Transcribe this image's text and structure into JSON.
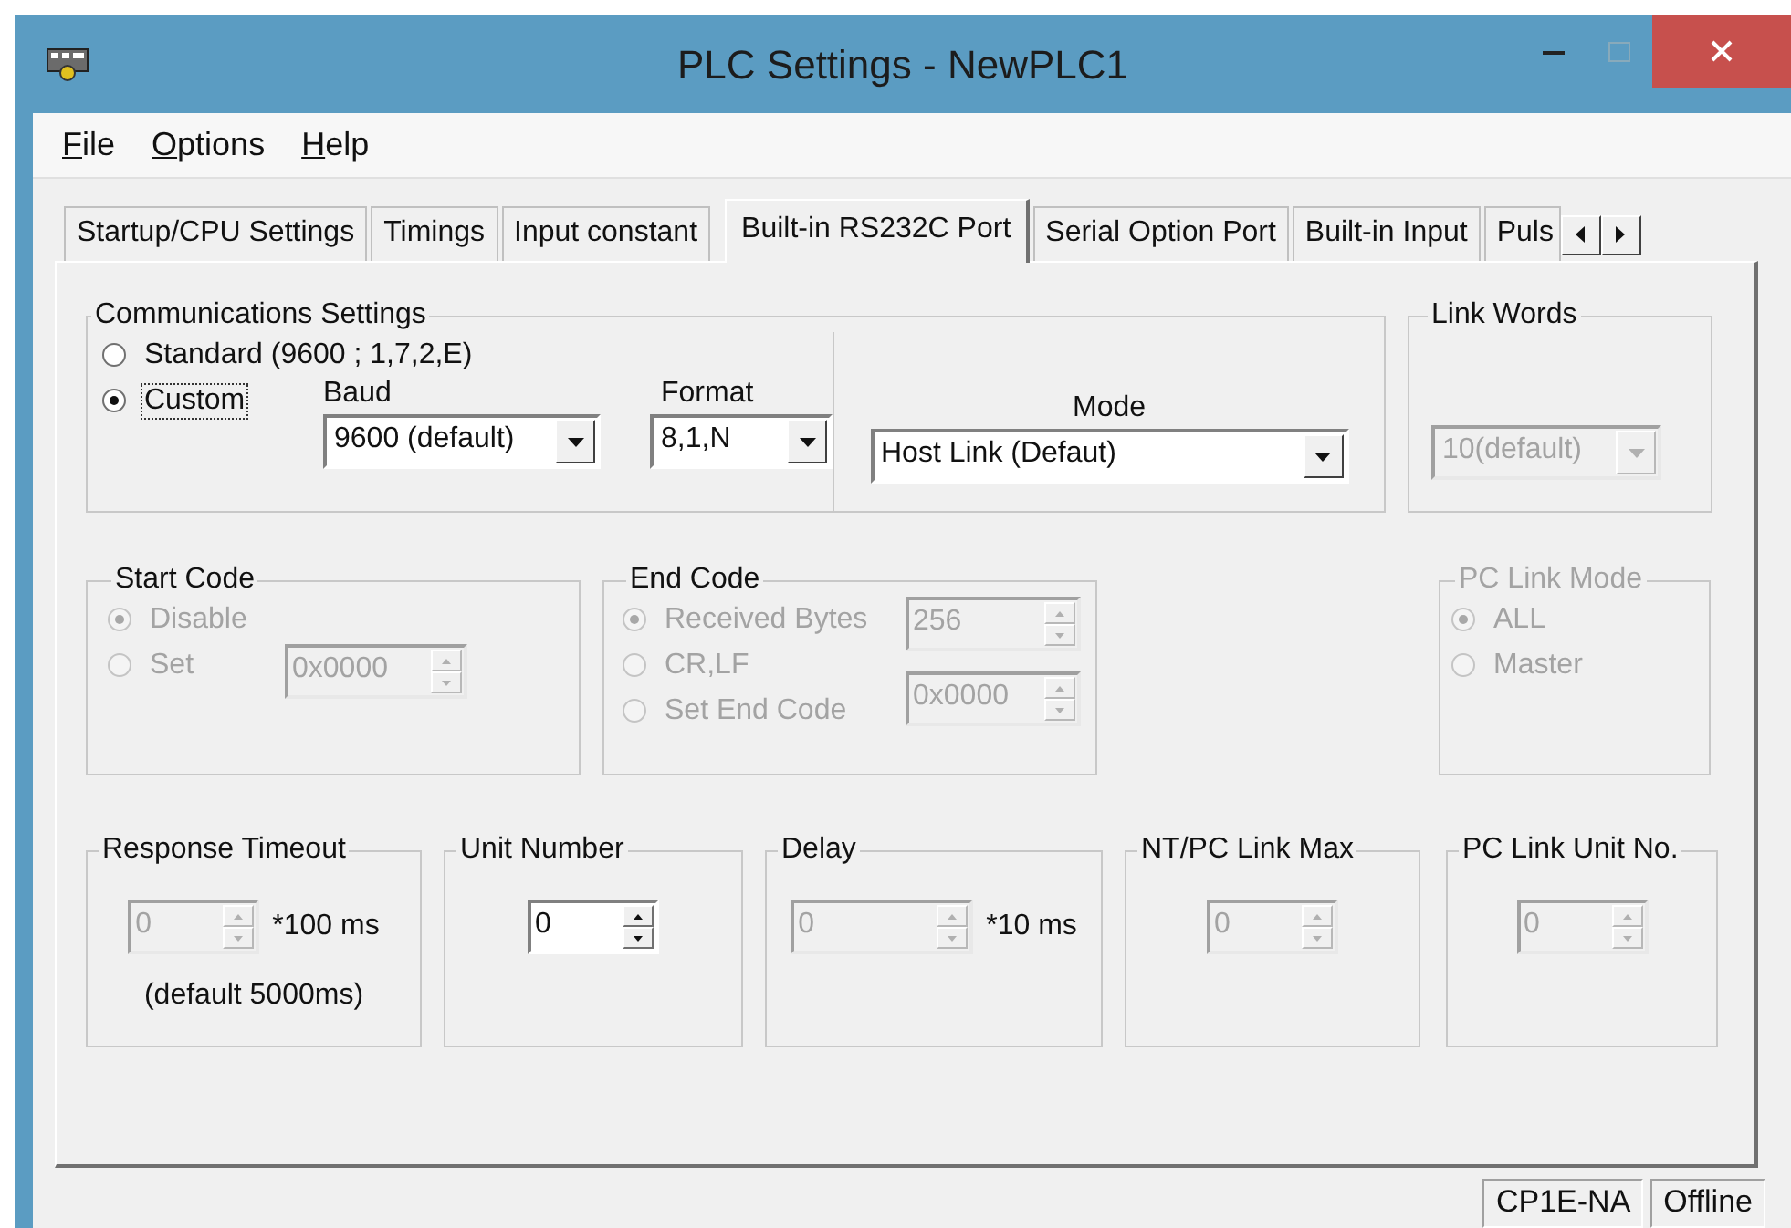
{
  "window": {
    "title": "PLC Settings - NewPLC1"
  },
  "menu": [
    {
      "label": "File"
    },
    {
      "label": "Options"
    },
    {
      "label": "Help"
    }
  ],
  "tabs": [
    {
      "label": "Startup/CPU Settings",
      "selected": false
    },
    {
      "label": "Timings",
      "selected": false
    },
    {
      "label": "Input constant",
      "selected": false
    },
    {
      "label": "Built-in RS232C Port",
      "selected": true
    },
    {
      "label": "Serial Option Port",
      "selected": false
    },
    {
      "label": "Built-in Input",
      "selected": false
    },
    {
      "label": "Puls",
      "selected": false
    }
  ],
  "communications_settings": {
    "title": "Communications Settings",
    "radios": [
      {
        "label": "Standard (9600 ; 1,7,2,E)",
        "selected": false,
        "focused": false
      },
      {
        "label": "Custom",
        "selected": true,
        "focused": true
      }
    ],
    "baud": {
      "label": "Baud",
      "value": "9600 (default)",
      "disabled": false
    },
    "format": {
      "label": "Format",
      "value": "8,1,N",
      "disabled": false
    },
    "mode": {
      "label": "Mode",
      "value": "Host Link (Defaut)",
      "disabled": false
    }
  },
  "link_words": {
    "title": "Link Words",
    "disabled": false,
    "combo": {
      "value": "10(default)",
      "disabled": true
    }
  },
  "start_code": {
    "title": "Start Code",
    "disabled": false,
    "radios": [
      {
        "label": "Disable",
        "selected": true,
        "disabled": true
      },
      {
        "label": "Set",
        "selected": false,
        "disabled": true
      }
    ],
    "spin": {
      "value": "0x0000",
      "disabled": true
    }
  },
  "end_code": {
    "title": "End Code",
    "disabled": false,
    "radios": [
      {
        "label": "Received Bytes",
        "selected": true,
        "disabled": true
      },
      {
        "label": "CR,LF",
        "selected": false,
        "disabled": true
      },
      {
        "label": "Set End Code",
        "selected": false,
        "disabled": true
      }
    ],
    "bytes_spin": {
      "value": "256",
      "disabled": true
    },
    "code_spin": {
      "value": "0x0000",
      "disabled": true
    }
  },
  "pc_link_mode": {
    "title": "PC Link Mode",
    "disabled": true,
    "radios": [
      {
        "label": "ALL",
        "selected": true,
        "disabled": true
      },
      {
        "label": "Master",
        "selected": false,
        "disabled": true
      }
    ]
  },
  "numeric_groups": [
    {
      "title": "Response Timeout",
      "value": "0",
      "disabled": true,
      "unit": "*100 ms",
      "note": "(default 5000ms)"
    },
    {
      "title": "Unit Number",
      "value": "0",
      "disabled": false
    },
    {
      "title": "Delay",
      "value": "0",
      "disabled": true,
      "unit": "*10 ms"
    },
    {
      "title": "NT/PC Link Max",
      "value": "0",
      "disabled": true
    },
    {
      "title": "PC Link Unit No.",
      "value": "0",
      "disabled": true
    }
  ],
  "status_bar": [
    "CP1E-NA",
    "Offline"
  ]
}
